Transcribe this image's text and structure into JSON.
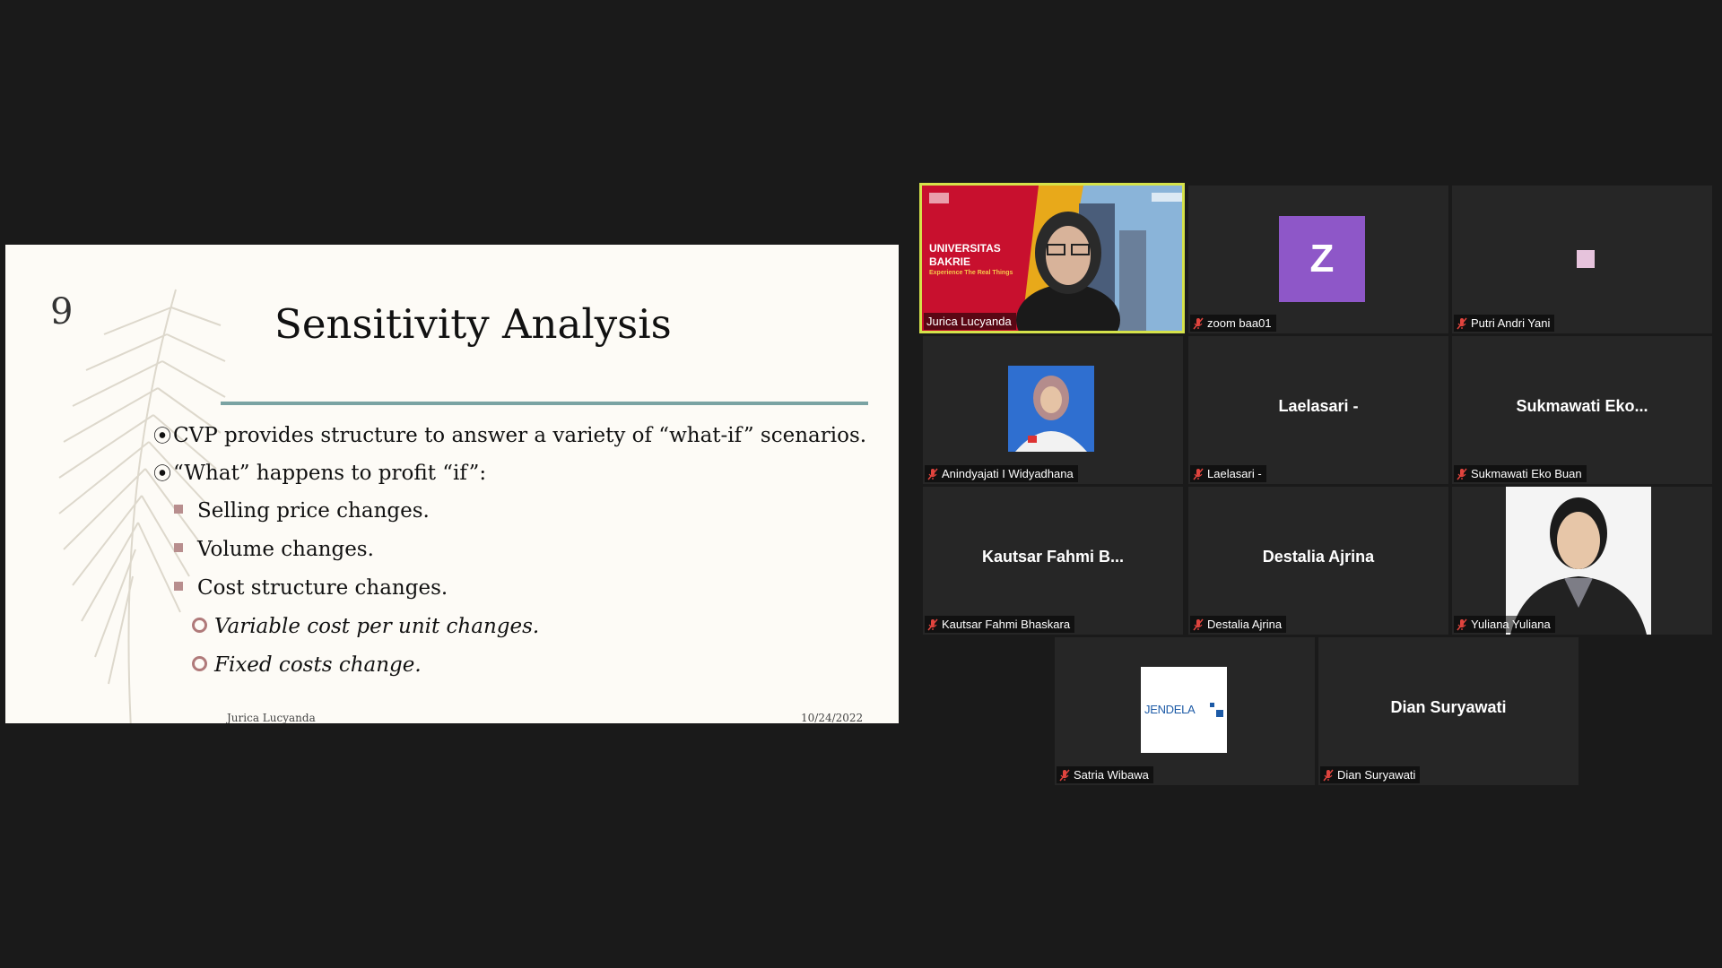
{
  "slide": {
    "number": "9",
    "title": "Sensitivity Analysis",
    "bullets_l1": [
      "CVP provides structure to answer a variety of  “what-if” scenarios.",
      "“What” happens to profit “if”:"
    ],
    "bullets_l2": [
      "Selling price changes.",
      "Volume changes.",
      "Cost structure changes."
    ],
    "bullets_l3": [
      "Variable cost per unit changes.",
      "Fixed costs change."
    ],
    "footer_left": "Jurica Lucyanda",
    "footer_right": "10/24/2022"
  },
  "banner": {
    "line1": "UNIVERSITAS",
    "line2": "BAKRIE",
    "tagline": "Experience The Real Things"
  },
  "participants": [
    {
      "tag": "Jurica Lucyanda",
      "display": ""
    },
    {
      "tag": "zoom baa01",
      "display": "Z"
    },
    {
      "tag": "Putri Andri Yani",
      "display": ""
    },
    {
      "tag": "Anindyajati I Widyadhana",
      "display": ""
    },
    {
      "tag": "Laelasari -",
      "display": "Laelasari -"
    },
    {
      "tag": "Sukmawati Eko Buan",
      "display": "Sukmawati  Eko..."
    },
    {
      "tag": "Kautsar Fahmi Bhaskara",
      "display": "Kautsar  Fahmi  B..."
    },
    {
      "tag": "Destalia Ajrina",
      "display": "Destalia Ajrina"
    },
    {
      "tag": "Yuliana  Yuliana",
      "display": ""
    },
    {
      "tag": "Satria Wibawa",
      "display": "JENDELA"
    },
    {
      "tag": "Dian Suryawati",
      "display": "Dian Suryawati"
    }
  ],
  "colors": {
    "active_speaker_border": "#d5e24a",
    "mic_muted": "#e0443e",
    "avatar_z": "#8e57c8",
    "banner_red": "#c8102e",
    "rule": "#7aa3a3"
  }
}
